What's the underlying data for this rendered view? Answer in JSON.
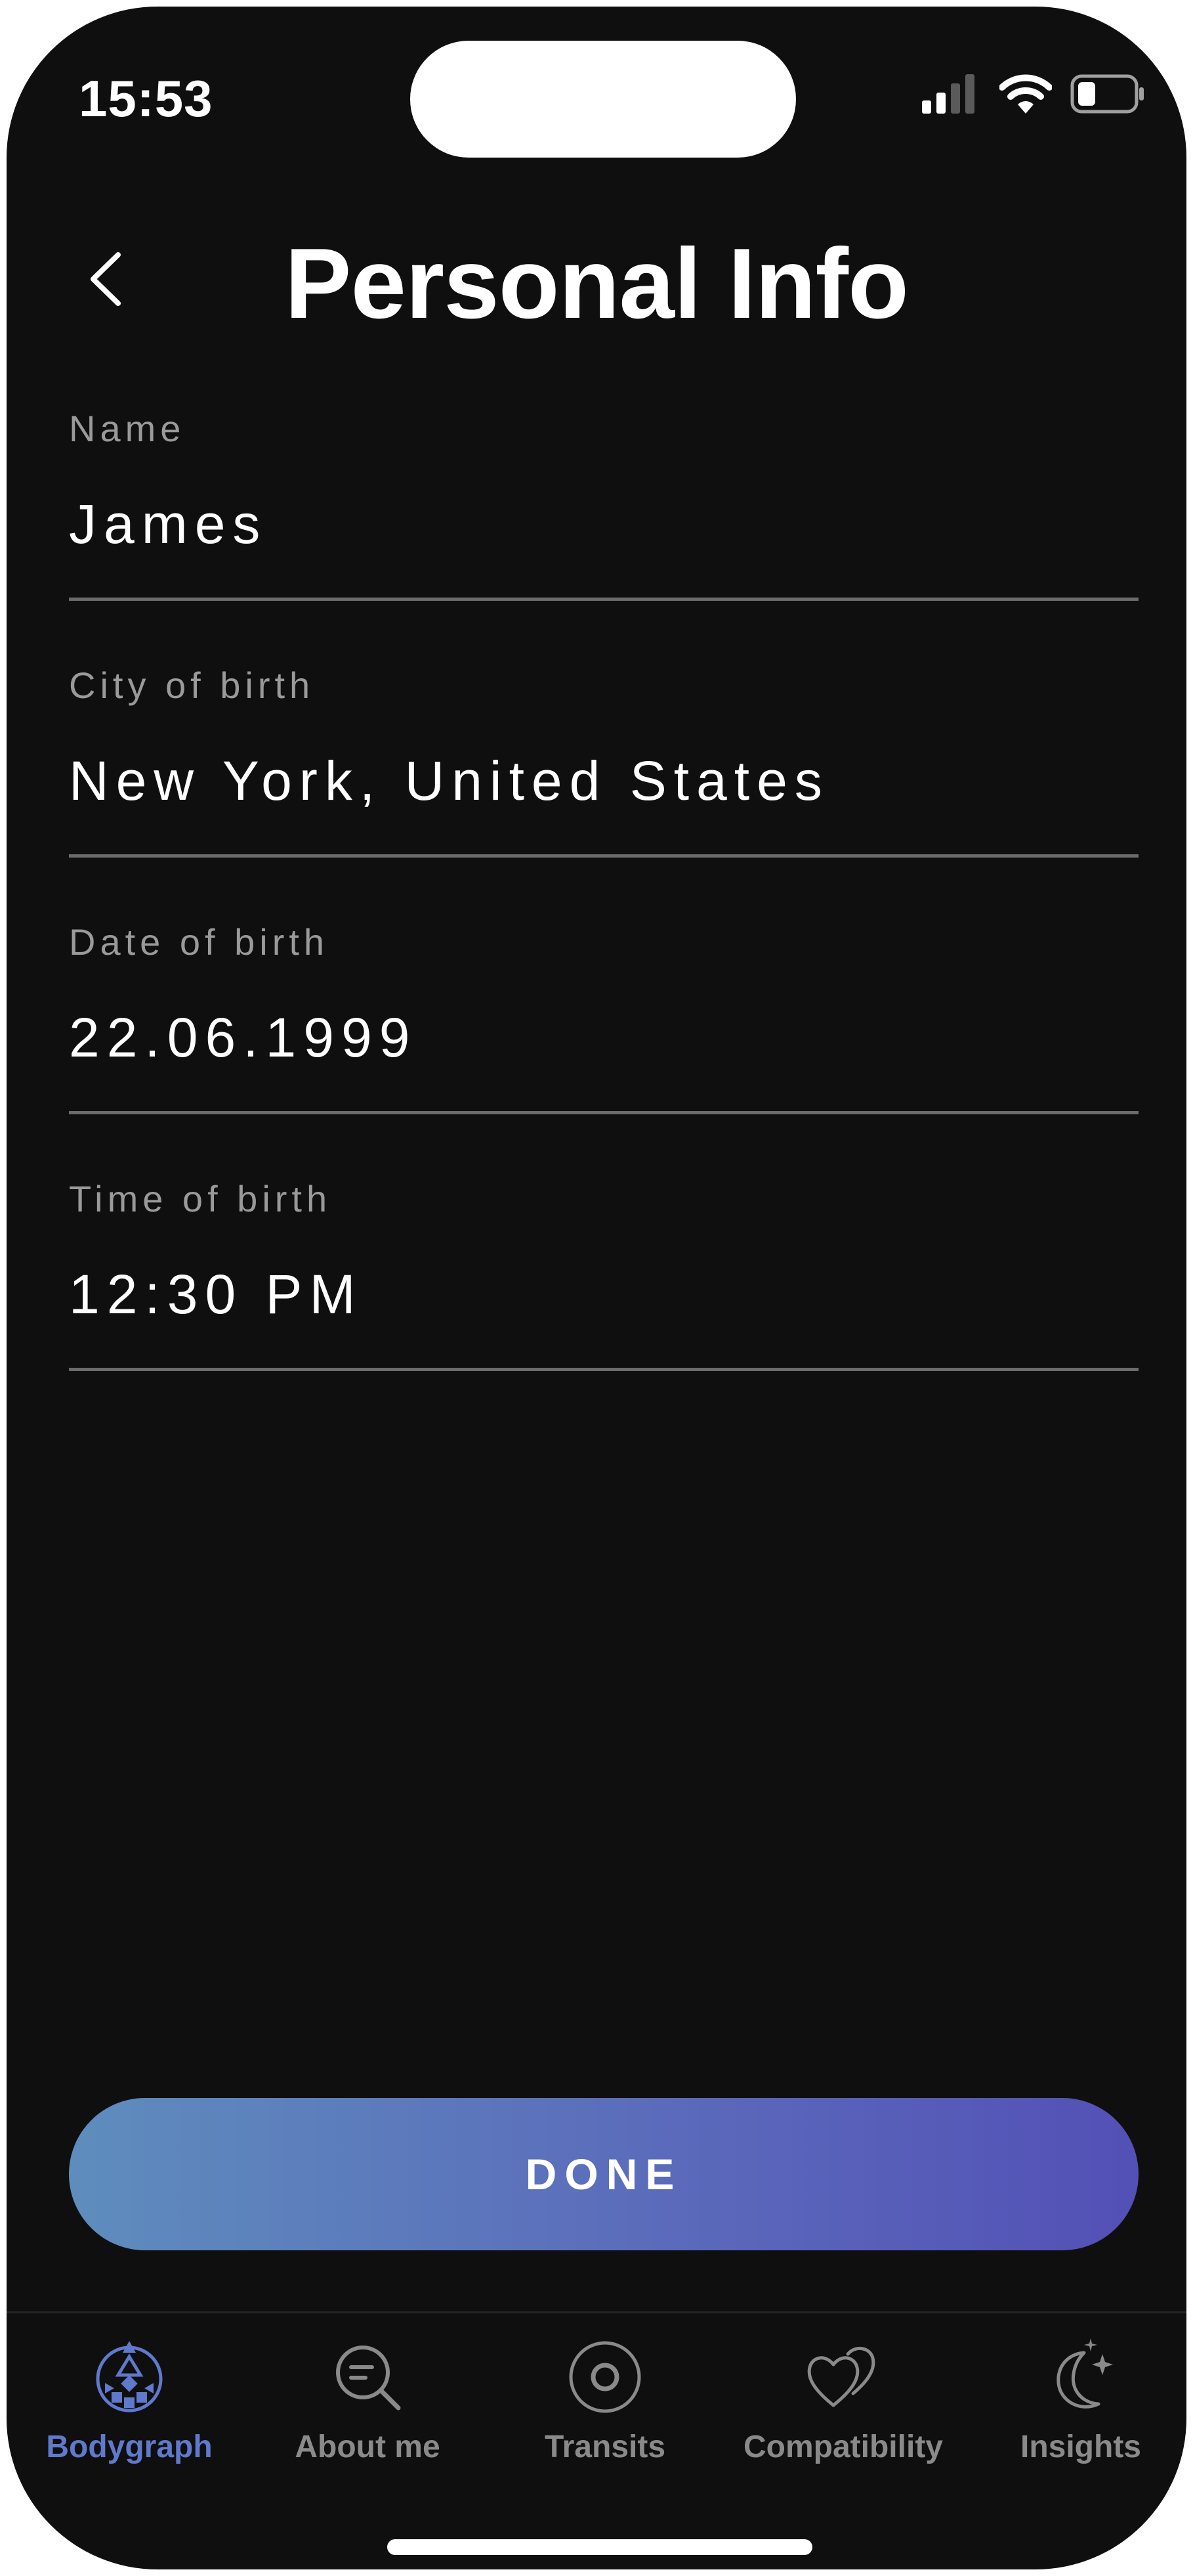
{
  "status_bar": {
    "time": "15:53"
  },
  "header": {
    "title": "Personal Info",
    "back_icon": "chevron-left-icon"
  },
  "fields": [
    {
      "label": "Name",
      "value": "James"
    },
    {
      "label": "City of birth",
      "value": "New York, United States"
    },
    {
      "label": "Date of birth",
      "value": "22.06.1999"
    },
    {
      "label": "Time of birth",
      "value": "12:30 PM"
    }
  ],
  "done_button": {
    "label": "DONE"
  },
  "tab_bar": {
    "tabs": [
      {
        "label": "Bodygraph",
        "icon": "bodygraph-icon",
        "active": true
      },
      {
        "label": "About me",
        "icon": "search-icon",
        "active": false
      },
      {
        "label": "Transits",
        "icon": "target-icon",
        "active": false
      },
      {
        "label": "Compatibility",
        "icon": "hearts-icon",
        "active": false
      },
      {
        "label": "Insights",
        "icon": "moon-stars-icon",
        "active": false
      }
    ]
  },
  "colors": {
    "background": "#0f0f0f",
    "accent": "#5f79cc",
    "button_gradient_start": "#5e8dbd",
    "button_gradient_end": "#5350b6",
    "inactive_tab": "#8a8a8a"
  }
}
